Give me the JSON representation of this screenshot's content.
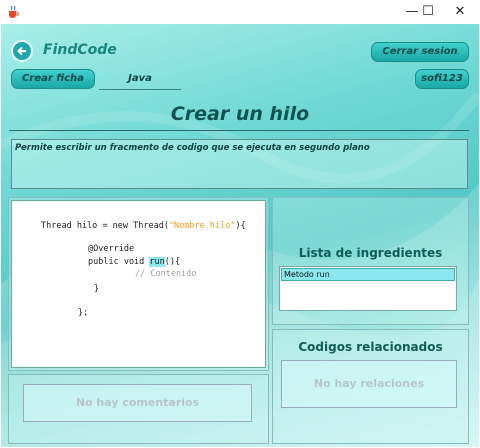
{
  "window": {
    "minimize_glyph": "—",
    "maximize_glyph": "☐",
    "close_glyph": "✕",
    "app_icon": "java-cup-icon"
  },
  "header": {
    "app_name": "FindCode",
    "back_icon": "back-arrow-icon",
    "logout_label": "Cerrar sesion",
    "create_label": "Crear ficha",
    "language": "Java",
    "username": "sofi123"
  },
  "main": {
    "title": "Crear un hilo",
    "description": "Permite escribir un fracmento de codigo que se ejecuta en segundo plano"
  },
  "code": {
    "line1_a": "Thread hilo = new Thread(",
    "line1_str": "\"Nombre hilo\"",
    "line1_b": "){",
    "line2": "@Override",
    "line3_a": "public void ",
    "line3_hl": "run",
    "line3_b": "(){",
    "line4": "// Contenido",
    "line5": "}",
    "line6": "};"
  },
  "ingredients": {
    "title": "Lista de ingredientes",
    "items": [
      "Metodo run"
    ]
  },
  "related": {
    "title": "Codigos relacionados",
    "empty_text": "No hay relaciones"
  },
  "comments": {
    "empty_text": "No hay comentarios"
  },
  "colors": {
    "accent": "#1aa8a6",
    "selection": "#8be8ef",
    "title_text": "#0f5350"
  }
}
